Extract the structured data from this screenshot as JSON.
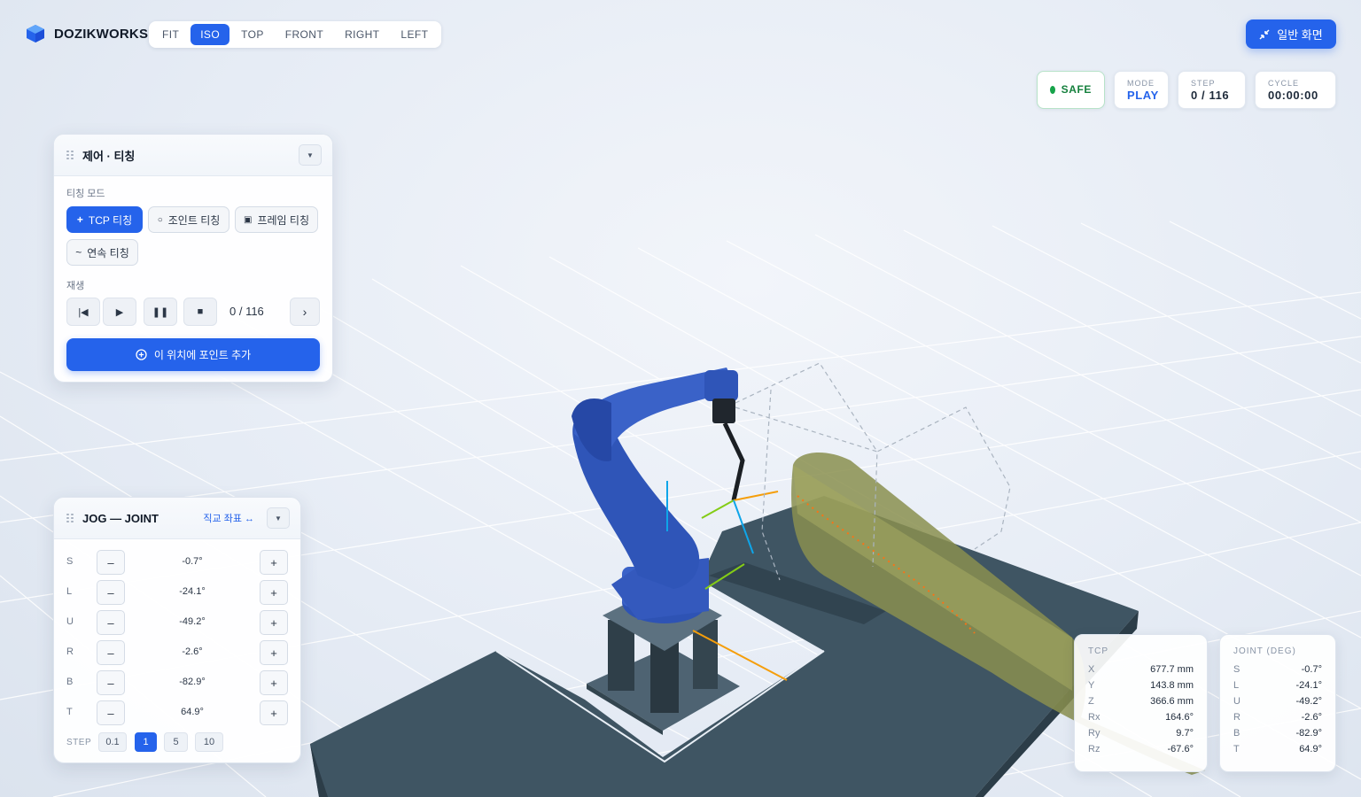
{
  "brand": {
    "name": "DOZIKWORKS"
  },
  "view_buttons": [
    "FIT",
    "ISO",
    "TOP",
    "FRONT",
    "RIGHT",
    "LEFT"
  ],
  "active_view": "ISO",
  "fullscreen_label": "일반 화면",
  "status": {
    "safe": "SAFE",
    "mode_label": "MODE",
    "mode_value": "PLAY",
    "step_label": "STEP",
    "step_value": "0 / 116",
    "cycle_label": "CYCLE",
    "cycle_value": "00:00:00"
  },
  "control_panel": {
    "title": "제어 · 티칭",
    "teach_mode_label": "티칭 모드",
    "teach_buttons": [
      {
        "label": "TCP 티칭",
        "icon": "plus-icon",
        "active": true
      },
      {
        "label": "조인트 티칭",
        "icon": "joint-icon",
        "active": false
      },
      {
        "label": "프레임 티칭",
        "icon": "frame-icon",
        "active": false
      },
      {
        "label": "연속 티칭",
        "icon": "wave-icon",
        "active": false
      }
    ],
    "playback_label": "재생",
    "counter": "0 / 116",
    "add_point_label": "이 위치에 포인트 추가"
  },
  "jog_panel": {
    "title": "JOG — JOINT",
    "coord_toggle": "직교 좌표 ↔",
    "joints": [
      {
        "name": "S",
        "value": "-0.7°"
      },
      {
        "name": "L",
        "value": "-24.1°"
      },
      {
        "name": "U",
        "value": "-49.2°"
      },
      {
        "name": "R",
        "value": "-2.6°"
      },
      {
        "name": "B",
        "value": "-82.9°"
      },
      {
        "name": "T",
        "value": "64.9°"
      }
    ],
    "minus": "–",
    "plus": "+",
    "step_label": "STEP",
    "steps": [
      "0.1",
      "1",
      "5",
      "10"
    ],
    "active_step": "1"
  },
  "tcp_readout": {
    "title": "TCP",
    "rows": [
      {
        "k": "X",
        "v": "677.7 mm"
      },
      {
        "k": "Y",
        "v": "143.8 mm"
      },
      {
        "k": "Z",
        "v": "366.6 mm"
      },
      {
        "k": "Rx",
        "v": "164.6°"
      },
      {
        "k": "Ry",
        "v": "9.7°"
      },
      {
        "k": "Rz",
        "v": "-67.6°"
      }
    ]
  },
  "joint_readout": {
    "title": "JOINT (DEG)",
    "rows": [
      {
        "k": "S",
        "v": "-0.7°"
      },
      {
        "k": "L",
        "v": "-24.1°"
      },
      {
        "k": "U",
        "v": "-49.2°"
      },
      {
        "k": "R",
        "v": "-2.6°"
      },
      {
        "k": "B",
        "v": "-82.9°"
      },
      {
        "k": "T",
        "v": "64.9°"
      }
    ]
  },
  "colors": {
    "accent": "#2563eb",
    "safe": "#16a34a",
    "robot": "#2f55b8",
    "table": "#3f5563",
    "workpiece": "#8a8f4f"
  }
}
